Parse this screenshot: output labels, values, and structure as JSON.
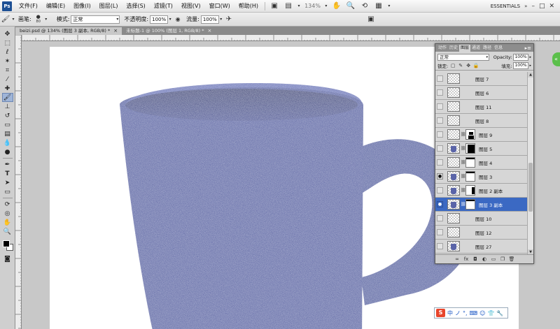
{
  "app": {
    "logo": "Ps"
  },
  "menubar": {
    "items": [
      "文件(F)",
      "编辑(E)",
      "图像(I)",
      "图层(L)",
      "选择(S)",
      "滤镜(T)",
      "视图(V)",
      "窗口(W)",
      "帮助(H)"
    ],
    "zoom": "134%",
    "workspace": "ESSENTIALS",
    "window_controls": [
      "–",
      "□",
      "✕"
    ]
  },
  "optionsbar": {
    "brush_label": "画笔:",
    "brush_size": "80",
    "mode_label": "模式:",
    "mode_value": "正常",
    "opacity_label": "不透明度:",
    "opacity_value": "100%",
    "flow_label": "流量:",
    "flow_value": "100%"
  },
  "doc_tabs": [
    {
      "label": "beizi.psd @ 134% (图层 3 副本, RGB/8) *",
      "close": "×",
      "active": true
    },
    {
      "label": "未标题-1 @ 100% (图层 1, RGB/8) *",
      "close": "×",
      "active": false
    }
  ],
  "layers_panel": {
    "tabs": [
      "动作",
      "历史",
      "图层",
      "通道",
      "路径",
      "信息"
    ],
    "active_tab": "图层",
    "menu": "▸≡",
    "blend_mode": "正常",
    "opacity_label": "Opacity:",
    "opacity_value": "100%",
    "lock_label": "锁定:",
    "fill_label": "填充:",
    "fill_value": "100%",
    "layers": [
      {
        "name": "图层 7",
        "visible": false,
        "selected": false,
        "thumb": "empty",
        "mask": null
      },
      {
        "name": "图层 6",
        "visible": false,
        "selected": false,
        "thumb": "empty",
        "mask": null
      },
      {
        "name": "图层 11",
        "visible": false,
        "selected": false,
        "thumb": "empty",
        "mask": null
      },
      {
        "name": "图层 8",
        "visible": false,
        "selected": false,
        "thumb": "empty",
        "mask": null
      },
      {
        "name": "图层 9",
        "visible": false,
        "selected": false,
        "thumb": "empty",
        "mask": "m1"
      },
      {
        "name": "图层 5",
        "visible": false,
        "selected": false,
        "thumb": "mug",
        "mask": "m2"
      },
      {
        "name": "图层 4",
        "visible": false,
        "selected": false,
        "thumb": "empty",
        "mask": "m3"
      },
      {
        "name": "图层 3",
        "visible": true,
        "selected": false,
        "thumb": "mug",
        "mask": "m3"
      },
      {
        "name": "图层 2 副本",
        "visible": false,
        "selected": false,
        "thumb": "mug",
        "mask": "m4"
      },
      {
        "name": "图层 3 副本",
        "visible": true,
        "selected": true,
        "thumb": "mug",
        "mask": "m3"
      },
      {
        "name": "图层 10",
        "visible": false,
        "selected": false,
        "thumb": "empty",
        "mask": null
      },
      {
        "name": "图层 12",
        "visible": false,
        "selected": false,
        "thumb": "empty",
        "mask": null
      },
      {
        "name": "图层 27",
        "visible": false,
        "selected": false,
        "thumb": "mug",
        "mask": null
      }
    ]
  },
  "ime": {
    "logo": "S",
    "items": [
      "中",
      "ノ",
      "°,",
      "⌨",
      "☺",
      "👕",
      "🔧"
    ]
  },
  "colors": {
    "mug": "#515ca0",
    "selection": "#3b69c3",
    "canvas_bg": "#c8c8c8"
  }
}
